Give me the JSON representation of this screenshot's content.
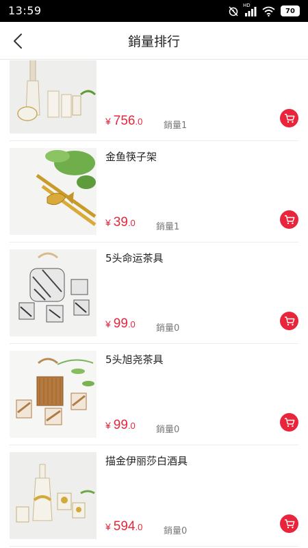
{
  "status_bar": {
    "time": "13:59",
    "network_label": "HD",
    "battery": "70",
    "icons": [
      "alarm-off-icon",
      "signal-icon",
      "wifi-icon",
      "battery-icon"
    ]
  },
  "nav": {
    "back_icon": "chevron-left-icon",
    "title": "銷量排行"
  },
  "colors": {
    "accent": "#e8253a",
    "text": "#222222",
    "muted": "#777777"
  },
  "products": [
    {
      "name": "",
      "currency": "¥",
      "price_int": "756",
      "price_dec": ".0",
      "sales": "銷量1",
      "image": "glass-decanter-set"
    },
    {
      "name": "金鱼筷子架",
      "currency": "¥",
      "price_int": "39",
      "price_dec": ".0",
      "sales": "銷量1",
      "image": "goldfish-chopstick-rest"
    },
    {
      "name": "5头命运茶具",
      "currency": "¥",
      "price_int": "99",
      "price_dec": ".0",
      "sales": "銷量0",
      "image": "marble-tea-set"
    },
    {
      "name": "5头旭尧茶具",
      "currency": "¥",
      "price_int": "99",
      "price_dec": ".0",
      "sales": "銷量0",
      "image": "bamboo-tea-set"
    },
    {
      "name": "描金伊丽莎白酒具",
      "currency": "¥",
      "price_int": "594",
      "price_dec": ".0",
      "sales": "銷量0",
      "image": "gold-wine-set"
    }
  ]
}
